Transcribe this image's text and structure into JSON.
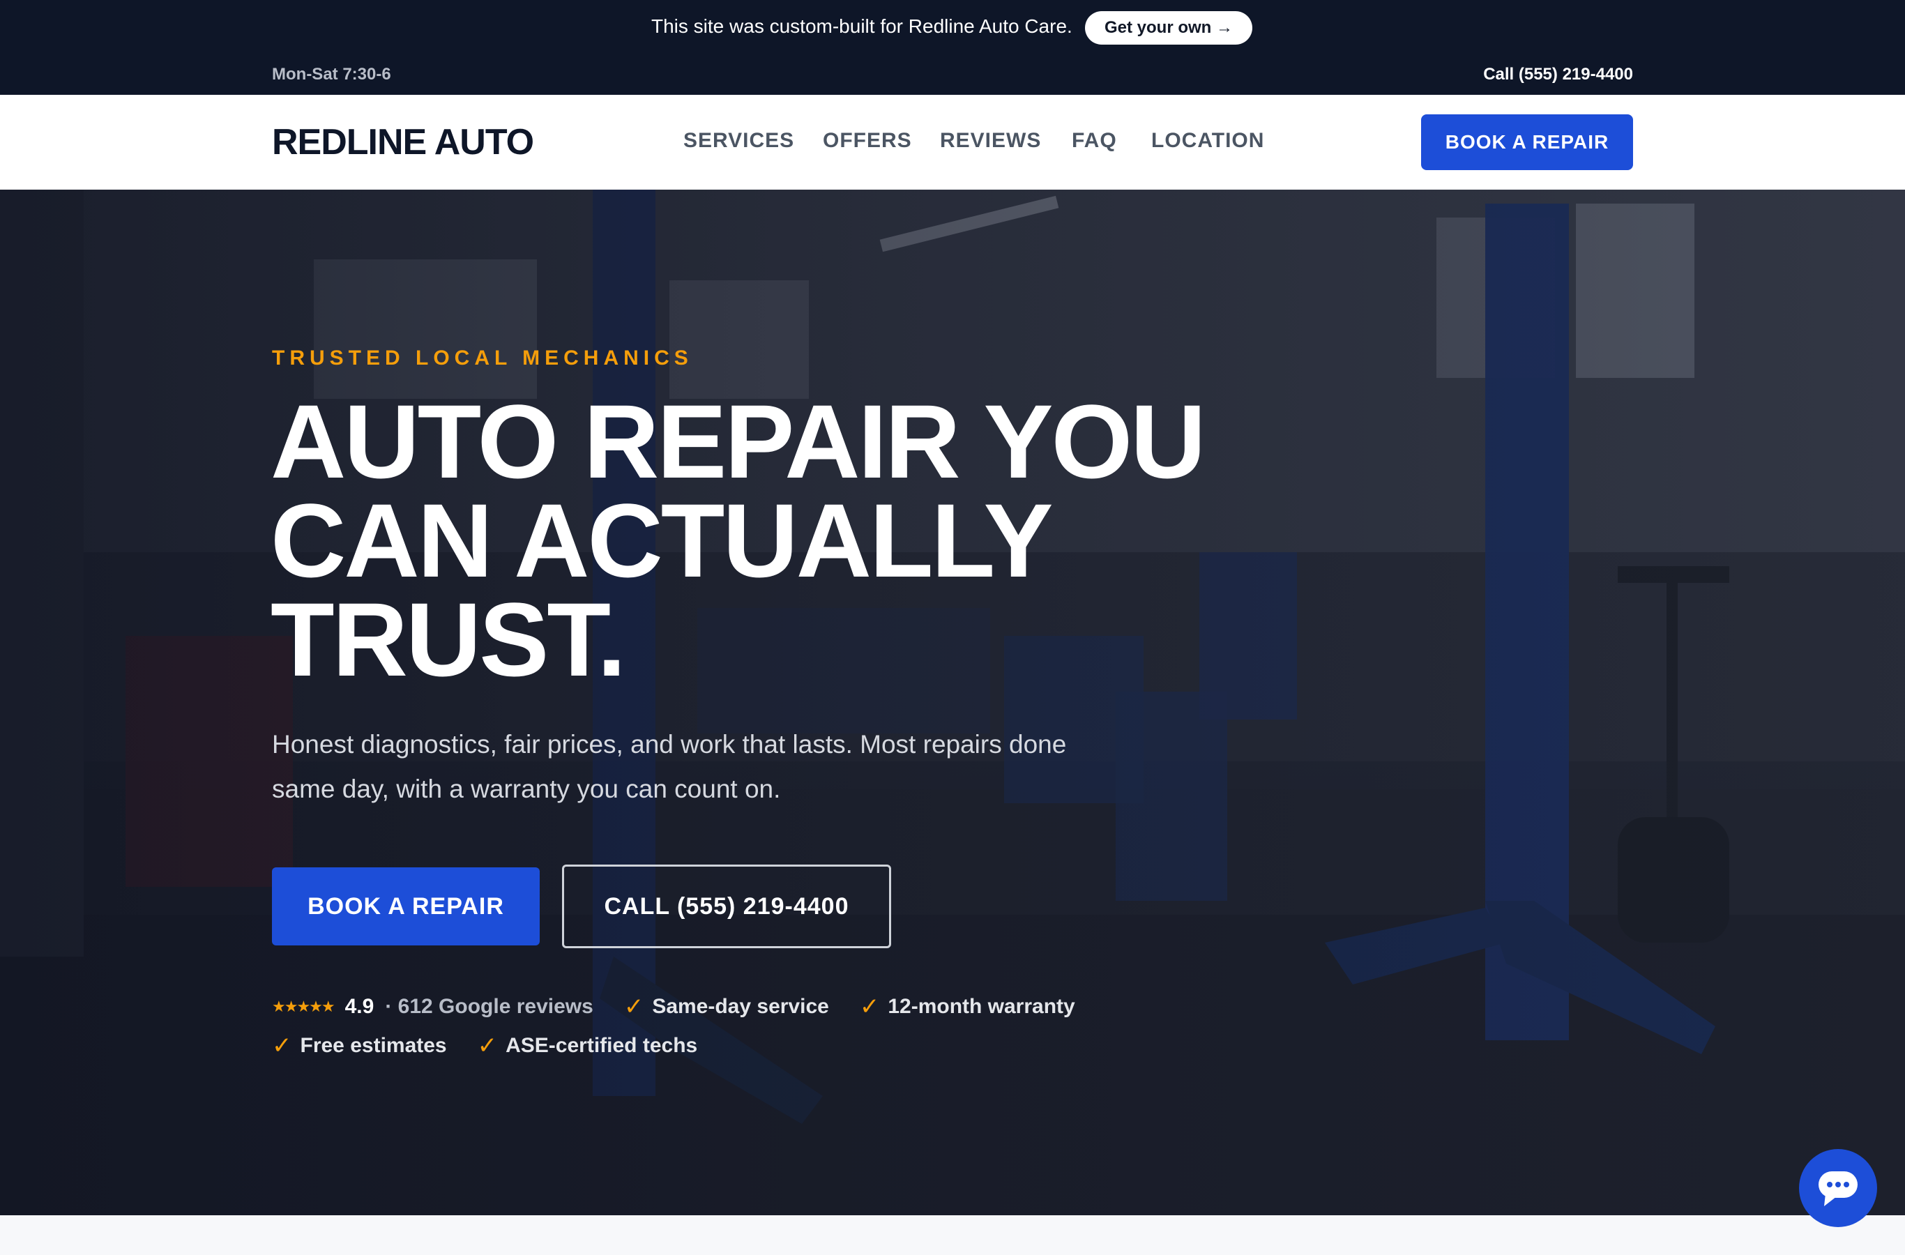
{
  "promo": {
    "text": "This site was custom-built for Redline Auto Care.",
    "button_label": "Get your own →"
  },
  "topbar": {
    "hours": "Mon-Sat 7:30-6",
    "phone": "Call (555) 219-4400"
  },
  "header": {
    "logo": "REDLINE AUTO",
    "nav": [
      "SERVICES",
      "OFFERS",
      "REVIEWS",
      "FAQ",
      "LOCATION"
    ],
    "cta_label": "BOOK A REPAIR"
  },
  "hero": {
    "eyebrow": "TRUSTED LOCAL MECHANICS",
    "headline_lines": [
      "AUTO REPAIR YOU",
      "CAN ACTUALLY",
      "TRUST."
    ],
    "subtext": "Honest diagnostics, fair prices, and work that lasts. Most repairs done same day, with a warranty you can count on.",
    "primary_cta": "BOOK A REPAIR",
    "secondary_cta": "CALL (555) 219-4400",
    "stars": "★★★★★",
    "rating": "4.9",
    "reviews": "· 612 Google reviews",
    "check_glyph": "✓",
    "badges": [
      "Same-day service",
      "12-month warranty",
      "Free estimates",
      "ASE-certified techs"
    ]
  },
  "icons": {
    "chat": "chat-bubble-icon",
    "check": "checkmark-icon",
    "stars": "star-rating-icon"
  },
  "colors": {
    "navy": "#0e1628",
    "brand_blue": "#1d4ed8",
    "accent_amber": "#f59e0b",
    "white": "#ffffff"
  }
}
